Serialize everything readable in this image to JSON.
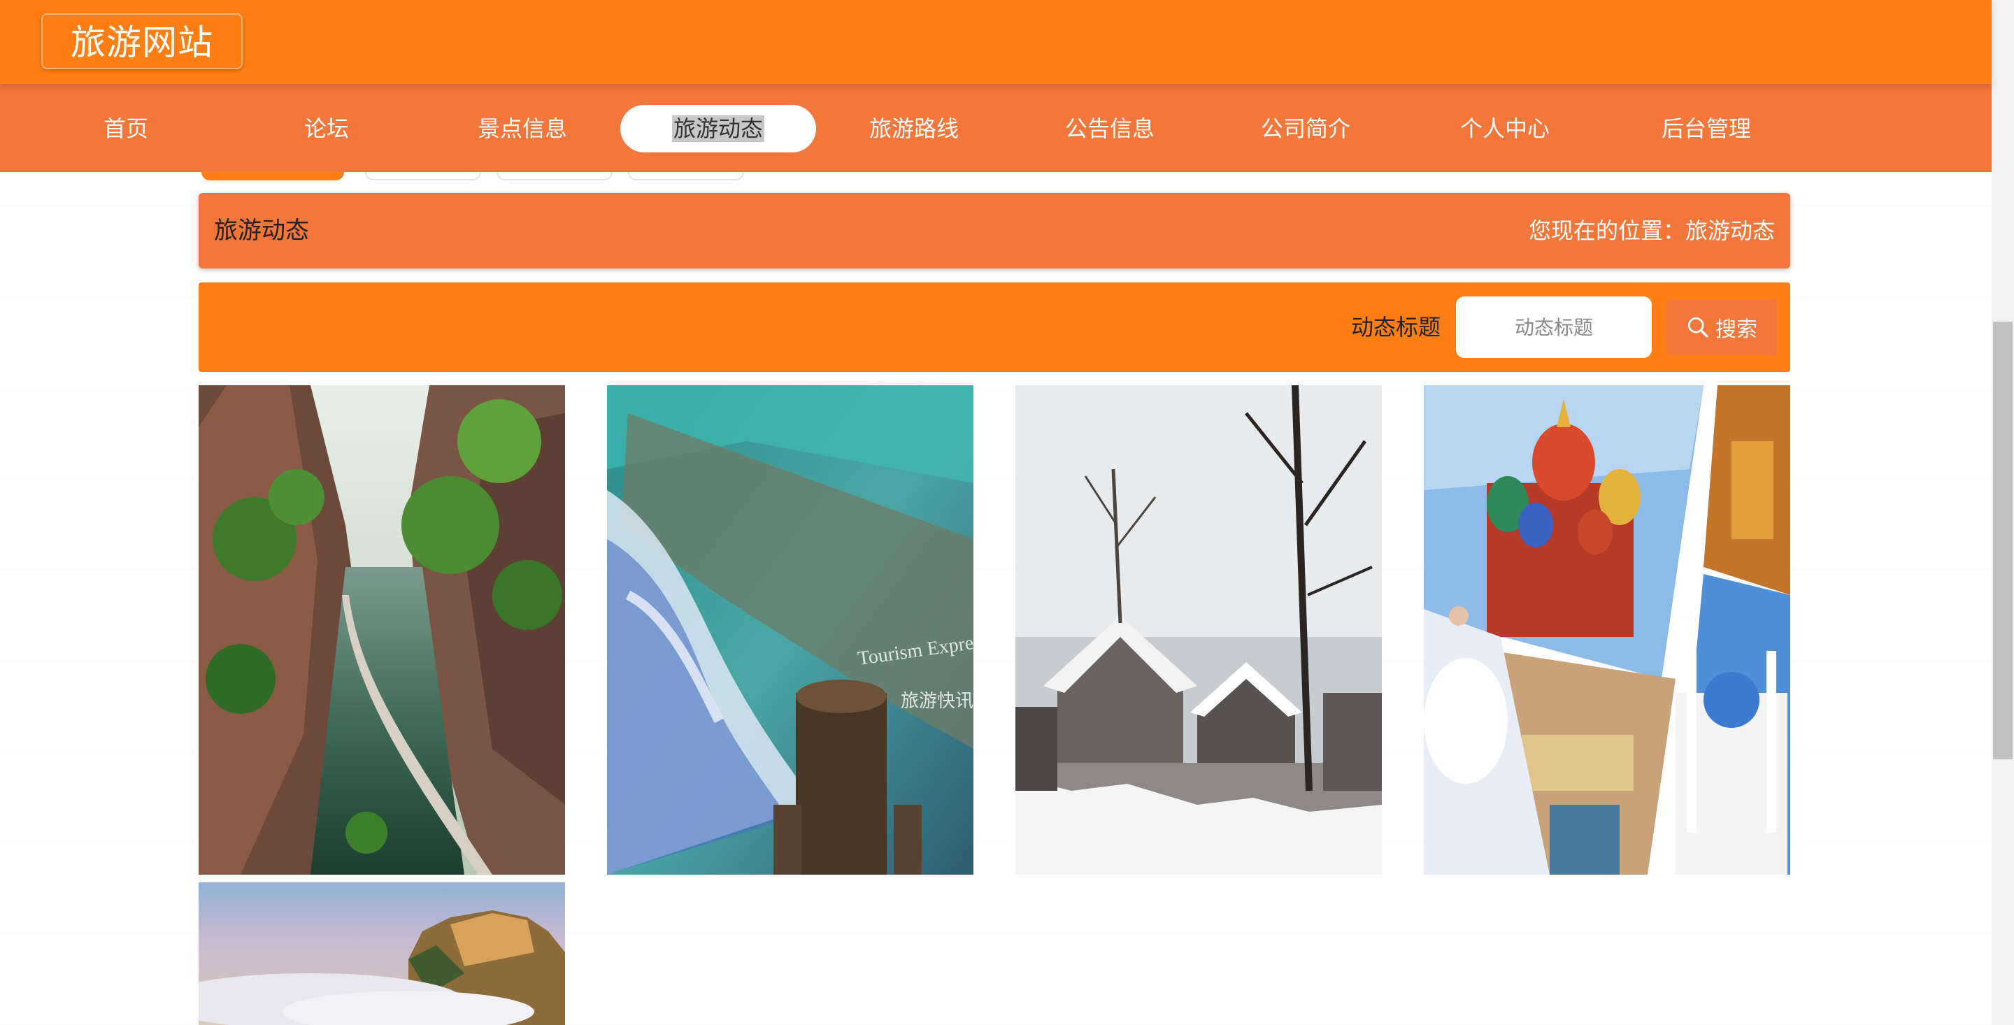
{
  "header": {
    "site_title": "旅游网站"
  },
  "nav": {
    "items": [
      {
        "label": "首页"
      },
      {
        "label": "论坛"
      },
      {
        "label": "景点信息"
      },
      {
        "label": "旅游动态"
      },
      {
        "label": "旅游路线"
      },
      {
        "label": "公告信息"
      },
      {
        "label": "公司简介"
      },
      {
        "label": "个人中心"
      },
      {
        "label": "后台管理"
      }
    ],
    "active_index": 3
  },
  "page": {
    "title": "旅游动态",
    "location_text": "您现在的位置：旅游动态"
  },
  "search": {
    "label": "动态标题",
    "placeholder": "动态标题",
    "button_label": "搜索"
  },
  "gallery": {
    "items": [
      {
        "image": "canyon-river-photo"
      },
      {
        "image": "waterfall-photo",
        "overlay_text_1": "Tourism Express",
        "overlay_text_2": "旅游快讯"
      },
      {
        "image": "snowy-village-photo"
      },
      {
        "image": "russia-collage-photo"
      },
      {
        "image": "mountain-sea-of-clouds-photo"
      }
    ]
  },
  "colors": {
    "primary": "#ff7f15",
    "secondary": "#f3763b"
  }
}
